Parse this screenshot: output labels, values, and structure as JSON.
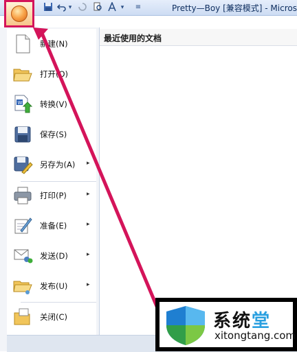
{
  "window": {
    "title": "Pretty—Boy [兼容模式] - Micros"
  },
  "quick_access": {
    "dropdown_glyph": "▾",
    "customize_glyph": "≡"
  },
  "menu": {
    "items": [
      {
        "label": "新建(N)",
        "icon": "new-document-icon",
        "submenu": false
      },
      {
        "label": "打开(O)",
        "icon": "open-folder-icon",
        "submenu": false
      },
      {
        "label": "转换(V)",
        "icon": "convert-icon",
        "submenu": false
      },
      {
        "label": "保存(S)",
        "icon": "save-icon",
        "submenu": false
      },
      {
        "label": "另存为(A)",
        "icon": "save-as-icon",
        "submenu": true
      },
      {
        "label": "打印(P)",
        "icon": "print-icon",
        "submenu": true
      },
      {
        "label": "准备(E)",
        "icon": "prepare-icon",
        "submenu": true
      },
      {
        "label": "发送(D)",
        "icon": "send-icon",
        "submenu": true
      },
      {
        "label": "发布(U)",
        "icon": "publish-icon",
        "submenu": true
      },
      {
        "label": "关闭(C)",
        "icon": "close-document-icon",
        "submenu": false
      }
    ],
    "submenu_glyph": "▸"
  },
  "recent": {
    "title": "最近使用的文档"
  },
  "watermark": {
    "text_main": "系统",
    "text_accent": "堂",
    "url": "xitongtang.com"
  },
  "colors": {
    "highlight": "#d4145a",
    "accent_blue": "#2aa0e0"
  }
}
